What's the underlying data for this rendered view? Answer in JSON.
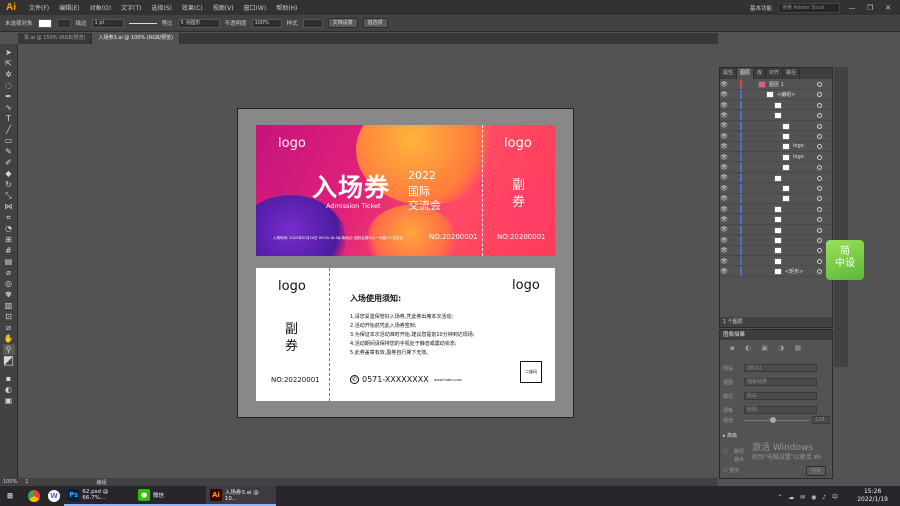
{
  "menubar": {
    "logo": "Ai",
    "items": [
      "文件(F)",
      "编辑(E)",
      "对象(O)",
      "文字(T)",
      "选择(S)",
      "效果(C)",
      "视图(V)",
      "窗口(W)",
      "帮助(H)"
    ],
    "workspace": "基本功能",
    "search_placeholder": "搜索 Adobe Stock",
    "minimize": "—",
    "restore": "❐",
    "close": "✕"
  },
  "controlbar": {
    "selection": "未选择对象",
    "stroke_label": "描边",
    "stroke_value": "1 pt",
    "line_label": "等比",
    "brush": "5 点圆形",
    "opacity_label": "不透明度",
    "opacity_value": "100%",
    "style_label": "样式",
    "doc_setup": "文档设置",
    "prefs": "首选项"
  },
  "tabs": [
    {
      "label": "票.ai @ 150% (RGB/预览)"
    },
    {
      "label": "入场券3.ai @ 100% (RGB/预览)"
    }
  ],
  "ticket": {
    "top": {
      "logo_left": "logo",
      "logo_right": "logo",
      "title": "入场券",
      "year": "2022",
      "line1": "国际",
      "line2": "交流会",
      "subtitle": "Admission Ticket",
      "time_text": "入场时间: 2022年01月20日 09:00-18:00",
      "place_text": "入场地点: 国际会展中心一号楼122会议室",
      "no_left": "NO:20200001",
      "no_right": "NO:20200001",
      "stub_line1": "副",
      "stub_line2": "券"
    },
    "bottom": {
      "logo_left": "logo",
      "logo_right": "logo",
      "stub_line1": "副",
      "stub_line2": "券",
      "no": "NO:20220001",
      "notes_title": "入场使用须知:",
      "notes": [
        "1.请您妥善保管好入场券,凭此券出席本次活动;",
        "2.活动开始前凭此入场券签到;",
        "3.为保证本次活动准时开始,建议您提前10分钟到达现场;",
        "4.活动期间请保持您的手机处于静音或震动状态;",
        "5.此券盖章有效,副券自行撕下无效。"
      ],
      "phone": "0571-XXXXXXXX",
      "website": "www.fudou.com",
      "qr_label": "二维码"
    }
  },
  "layers_panel": {
    "tabs": [
      "属性",
      "图层",
      "库",
      "对齐",
      "路径"
    ],
    "rows": [
      "图层 1",
      "<编组>",
      "",
      "",
      "",
      "",
      "logo",
      "logo",
      "",
      "",
      "",
      "",
      "",
      "",
      "",
      "",
      "",
      "",
      "<矩形>"
    ],
    "footer": "1 个图层"
  },
  "trace_panel": {
    "title": "图像描摹",
    "preset_label": "预设",
    "preset_value": "[默认]",
    "view_label": "视图",
    "view_value": "描摹结果",
    "mode_label": "模式",
    "mode_value": "黑白",
    "palette_label": "调板",
    "palette_value": "受限",
    "threshold_label": "阈值",
    "threshold_value": "128",
    "advanced": "高级",
    "paths_label": "路径",
    "anchors_label": "锚点",
    "preview_label": "预览",
    "trace_button": "描摹"
  },
  "activation": {
    "line1": "激活 Windows",
    "line2": "转到\"电脑设置\"以激活 Wi"
  },
  "statusbar": {
    "zoom": "100%",
    "artboard": "1",
    "mode": "编组"
  },
  "taskbar": {
    "apps": [
      {
        "label": "",
        "icon": "chrome-icon"
      },
      {
        "label": "",
        "icon": "wps-icon"
      },
      {
        "label": "62.psd @ 66.7%...",
        "icon": "ps-icon"
      },
      {
        "label": "微信",
        "icon": "wechat-icon"
      },
      {
        "label": "入场券3.ai @ 10...",
        "icon": "ai-icon"
      }
    ],
    "time": "15:26",
    "date": "2022/1/19"
  },
  "widget": {
    "line1": "简",
    "line2": "中设"
  },
  "colors": {
    "menubar": "#323232",
    "panel": "#535353",
    "accent_ai": "#ff9a00",
    "ticket_magenta": "#d4187a",
    "ticket_pink": "#ff4b66"
  }
}
